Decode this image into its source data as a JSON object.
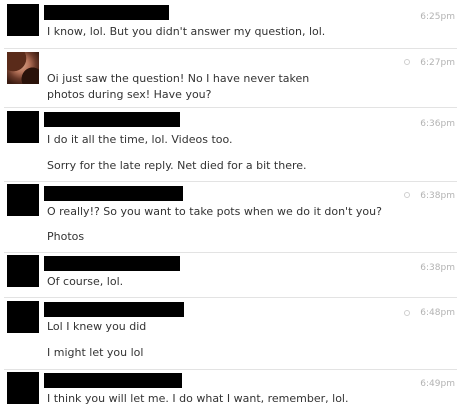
{
  "messages": [
    {
      "time": "6:25pm",
      "lines": [
        "I know, lol. But you didn't answer my question, lol."
      ]
    },
    {
      "time": "6:27pm",
      "lines": [
        "Oi just saw the question! No I have never taken photos during sex! Have you?"
      ]
    },
    {
      "time": "6:36pm",
      "lines": [
        "I do it all the time, lol. Videos too.",
        "Sorry for the late reply. Net died for a bit there."
      ]
    },
    {
      "time": "6:38pm",
      "lines": [
        "O really!? So you want to take pots when we do it don't you?",
        "Photos"
      ]
    },
    {
      "time": "6:38pm",
      "lines": [
        "Of course, lol."
      ]
    },
    {
      "time": "6:48pm",
      "lines": [
        "Lol I knew you did",
        "I might let you lol"
      ]
    },
    {
      "time": "6:49pm",
      "lines": [
        "I think you will let me. I do what I want, remember, lol."
      ]
    }
  ]
}
